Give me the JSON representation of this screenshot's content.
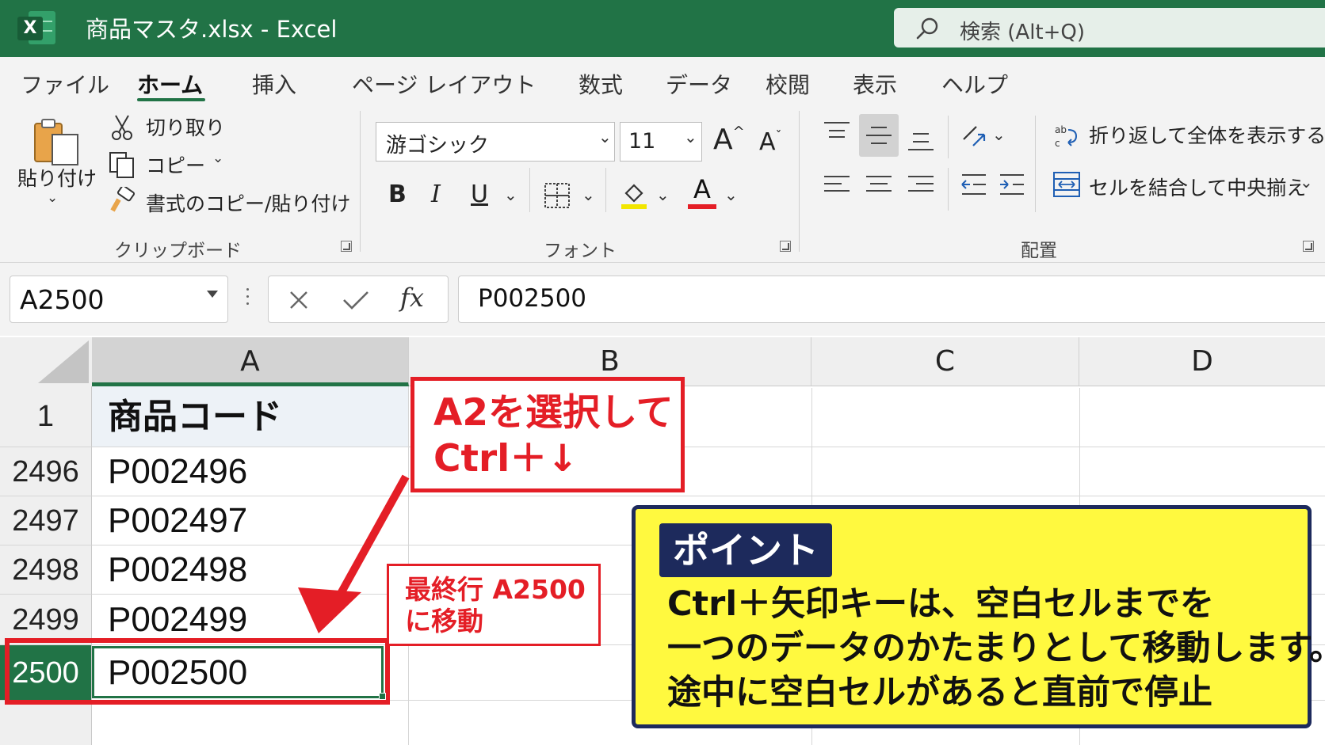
{
  "window": {
    "app_icon_letter": "X",
    "title": "商品マスタ.xlsx  -  Excel",
    "search_placeholder": "検索 (Alt+Q)"
  },
  "ribbon_tabs": [
    "ファイル",
    "ホーム",
    "挿入",
    "ページ レイアウト",
    "数式",
    "データ",
    "校閲",
    "表示",
    "ヘルプ"
  ],
  "active_tab": "ホーム",
  "clipboard": {
    "paste_label": "貼り付け",
    "cut_label": "切り取り",
    "copy_label": "コピー",
    "format_painter_label": "書式のコピー/貼り付け",
    "group_label": "クリップボード"
  },
  "font": {
    "family": "游ゴシック",
    "size": "11",
    "bold": "B",
    "italic": "I",
    "underline": "U",
    "font_color_glyph": "A",
    "group_label": "フォント",
    "highlight_color": "#f2e600",
    "font_color": "#e41e26"
  },
  "alignment": {
    "wrap_text_label": "折り返して全体を表示する",
    "merge_center_label": "セルを結合して中央揃え",
    "group_label": "配置"
  },
  "formula_bar": {
    "name_box": "A2500",
    "fx": "fx",
    "value": "P002500"
  },
  "sheet": {
    "columns": [
      "A",
      "B",
      "C",
      "D"
    ],
    "selected_column": "A",
    "rows": [
      {
        "row": "1",
        "a": "商品コード"
      },
      {
        "row": "2496",
        "a": "P002496"
      },
      {
        "row": "2497",
        "a": "P002497"
      },
      {
        "row": "2498",
        "a": "P002498"
      },
      {
        "row": "2499",
        "a": "P002499"
      },
      {
        "row": "2500",
        "a": "P002500"
      }
    ],
    "active_row": "2500",
    "accent_color": "#217346"
  },
  "annotations": {
    "step": "A2を選択して\nCtrl＋↓",
    "result": "最終行 A2500\nに移動",
    "point_title": "ポイント",
    "point_body": "Ctrl＋矢印キーは、空白セルまでを\n一つのデータのかたまりとして移動します。\n途中に空白セルがあると直前で停止",
    "highlight_color": "#e41e26",
    "point_bg": "#fff93f"
  }
}
